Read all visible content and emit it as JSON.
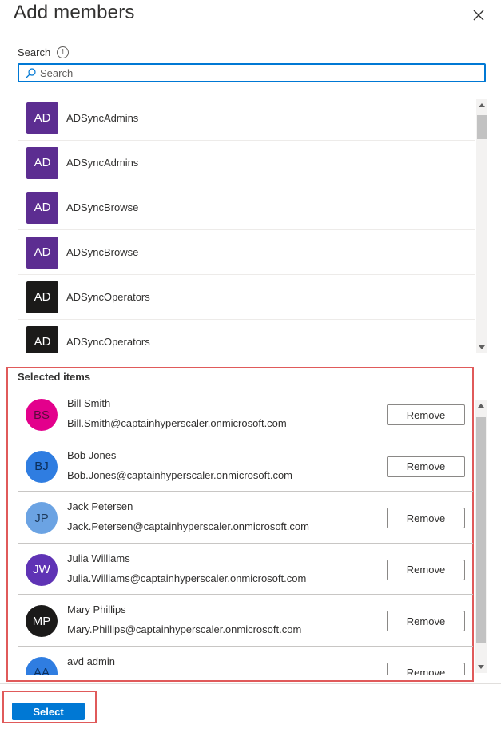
{
  "panel": {
    "title": "Add members"
  },
  "search": {
    "label": "Search",
    "placeholder": "Search",
    "value": ""
  },
  "results": [
    {
      "initials": "AD",
      "name": "ADSyncAdmins",
      "color": "#5c2d91"
    },
    {
      "initials": "AD",
      "name": "ADSyncAdmins",
      "color": "#5c2d91"
    },
    {
      "initials": "AD",
      "name": "ADSyncBrowse",
      "color": "#5c2d91"
    },
    {
      "initials": "AD",
      "name": "ADSyncBrowse",
      "color": "#5c2d91"
    },
    {
      "initials": "AD",
      "name": "ADSyncOperators",
      "color": "#1b1a19"
    },
    {
      "initials": "AD",
      "name": "ADSyncOperators",
      "color": "#1b1a19"
    }
  ],
  "selected": {
    "title": "Selected items",
    "remove_label": "Remove",
    "items": [
      {
        "initials": "BS",
        "name": "Bill Smith",
        "email": "Bill.Smith@captainhyperscaler.onmicrosoft.com",
        "color": "#e3008c"
      },
      {
        "initials": "BJ",
        "name": "Bob Jones",
        "email": "Bob.Jones@captainhyperscaler.onmicrosoft.com",
        "color": "#2f7de1"
      },
      {
        "initials": "JP",
        "name": "Jack Petersen",
        "email": "Jack.Petersen@captainhyperscaler.onmicrosoft.com",
        "color": "#6ba3e3"
      },
      {
        "initials": "JW",
        "name": "Julia Williams",
        "email": "Julia.Williams@captainhyperscaler.onmicrosoft.com",
        "color": "#5f33b5"
      },
      {
        "initials": "MP",
        "name": "Mary Phillips",
        "email": "Mary.Phillips@captainhyperscaler.onmicrosoft.com",
        "color": "#1b1a19"
      },
      {
        "initials": "AA",
        "name": "avd admin",
        "email": "",
        "color": "#2f7de1"
      }
    ]
  },
  "footer": {
    "select_label": "Select"
  },
  "colors": {
    "accent": "#0078d4",
    "highlight": "#e05a5a"
  },
  "icons": {
    "close": "close-icon",
    "info": "info-icon",
    "search": "search-icon"
  }
}
